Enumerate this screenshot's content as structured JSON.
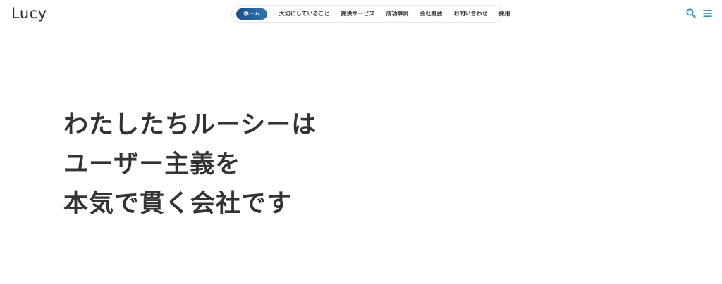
{
  "header": {
    "logo": "Lucy",
    "nav": [
      {
        "label": "ホーム",
        "active": true
      },
      {
        "label": "大切にしていること",
        "active": false
      },
      {
        "label": "提供サービス",
        "active": false
      },
      {
        "label": "成功事例",
        "active": false
      },
      {
        "label": "会社概要",
        "active": false
      },
      {
        "label": "お問い合わせ",
        "active": false
      },
      {
        "label": "採用",
        "active": false
      }
    ],
    "icons": {
      "search": "search-icon",
      "menu": "hamburger-menu-icon"
    },
    "colors": {
      "accent": "#2a77b0",
      "accent_dark": "#1f4e8a",
      "icon": "#2a8fd0"
    }
  },
  "hero": {
    "lines": [
      "わたしたちルーシーは",
      "ユーザー主義を",
      "本気で貫く会社です"
    ]
  }
}
